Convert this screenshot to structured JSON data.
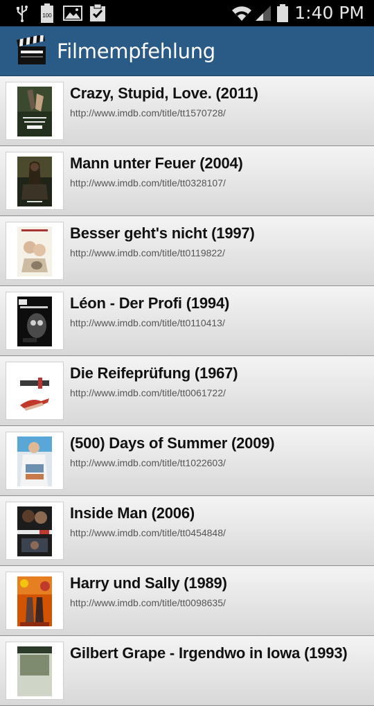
{
  "status_bar": {
    "time": "1:40 PM",
    "battery_label": "100",
    "icons": [
      "usb-icon",
      "battery-icon",
      "picture-icon",
      "clipboard-check-icon",
      "wifi-icon",
      "signal-icon",
      "battery-icon"
    ]
  },
  "action_bar": {
    "title": "Filmempfehlung",
    "icon": "clapperboard-icon",
    "color": "#2a5a86"
  },
  "movies": [
    {
      "title": "Crazy, Stupid, Love. (2011)",
      "url": "http://www.imdb.com/title/tt1570728/"
    },
    {
      "title": "Mann unter Feuer (2004)",
      "url": "http://www.imdb.com/title/tt0328107/"
    },
    {
      "title": "Besser geht's nicht (1997)",
      "url": "http://www.imdb.com/title/tt0119822/"
    },
    {
      "title": "Léon - Der Profi (1994)",
      "url": "http://www.imdb.com/title/tt0110413/"
    },
    {
      "title": "Die Reifeprüfung (1967)",
      "url": "http://www.imdb.com/title/tt0061722/"
    },
    {
      "title": "(500) Days of Summer (2009)",
      "url": "http://www.imdb.com/title/tt1022603/"
    },
    {
      "title": "Inside Man (2006)",
      "url": "http://www.imdb.com/title/tt0454848/"
    },
    {
      "title": "Harry und Sally (1989)",
      "url": "http://www.imdb.com/title/tt0098635/"
    },
    {
      "title": "Gilbert Grape - Irgendwo in Iowa (1993)",
      "url": ""
    }
  ]
}
